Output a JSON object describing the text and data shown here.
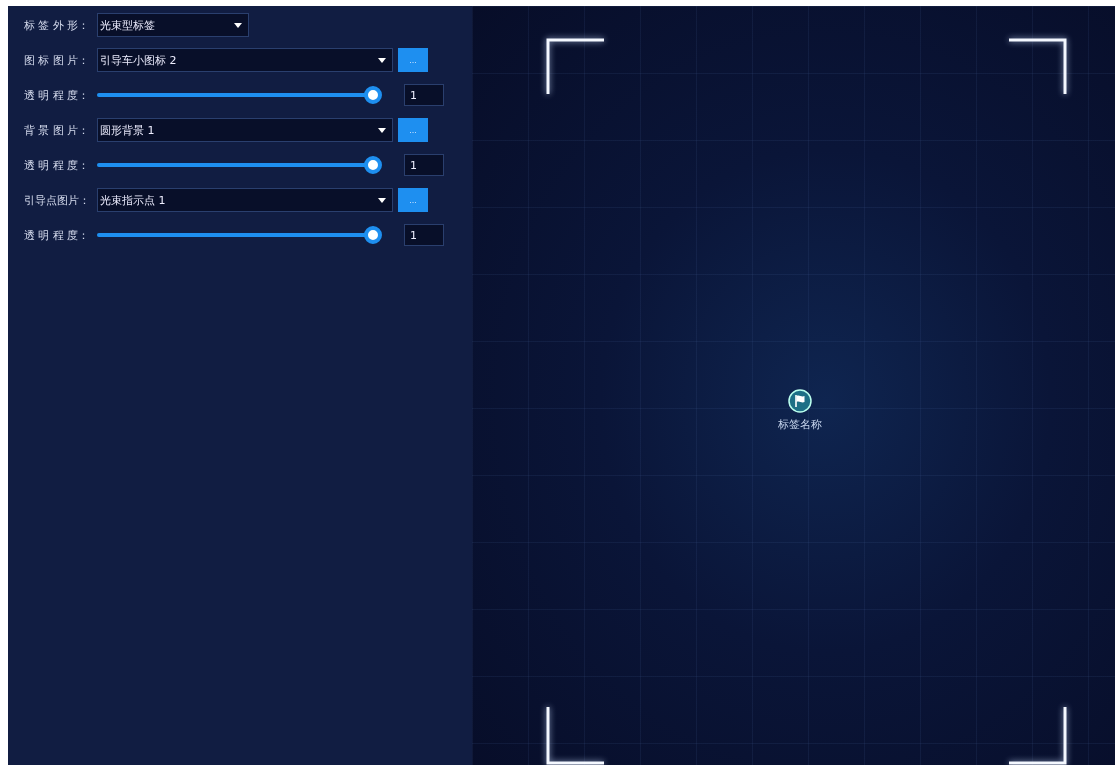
{
  "settings": [
    {
      "kind": "select",
      "label": "标 签 外 形：",
      "value": "光束型标签"
    },
    {
      "kind": "select",
      "label": "图 标 图 片：",
      "value": "引导车小图标 2",
      "browse": "..."
    },
    {
      "kind": "slider",
      "label": "透 明 程 度：",
      "level": 1,
      "value": "1"
    },
    {
      "kind": "select",
      "label": "背 景 图 片：",
      "value": "圆形背景 1",
      "browse": "..."
    },
    {
      "kind": "slider",
      "label": "透 明 程 度：",
      "level": 1,
      "value": "1"
    },
    {
      "kind": "select",
      "label": "引导点图片：",
      "value": "光束指示点 1",
      "browse": "..."
    },
    {
      "kind": "slider",
      "label": "透 明 程 度：",
      "level": 1,
      "value": "1"
    }
  ],
  "preview": {
    "tag_name": "标签名称"
  }
}
